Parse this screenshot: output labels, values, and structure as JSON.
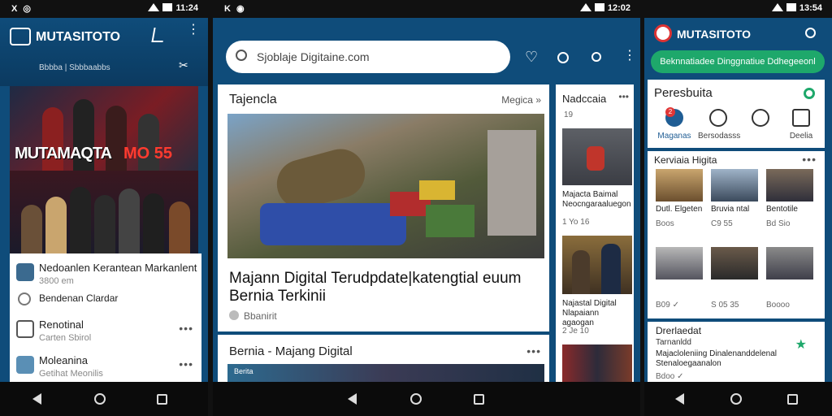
{
  "phone1": {
    "status_left": "X ◎",
    "status_time": "11:24",
    "brand": "MUTASITOTO",
    "subtitle": "Bbbba | Sbbbaabbs",
    "hero_title_a": "MUTAMAQTA",
    "hero_title_b": "MO 55",
    "list": [
      {
        "title": "Nedoanlen Kerantean Markanlent",
        "sub": "3800 em"
      },
      {
        "title": "Bendenan Clardar",
        "sub": ""
      },
      {
        "title": "Renotinal",
        "sub": "Carten Sbirol"
      },
      {
        "title": "Moleanina",
        "sub": "Getihat Meonilis"
      }
    ]
  },
  "phone2": {
    "status_left": "K ◉",
    "status_time": "12:02",
    "search_placeholder": "Sjoblaje Digitaine.com",
    "card_title": "Tajencla",
    "card_more": "Megica »",
    "headline": "Majann Digital Terudpdate|katengtial euum Bernia Terkinii",
    "source": "Bbanirit",
    "side_title": "Nadccaia",
    "side_count": "19",
    "side_items": [
      {
        "cap": "Majacta Baimal Neocngaraaluegon",
        "meta": "1 Yo 16"
      },
      {
        "cap": "Najastal Digital Nlapaiann agaogan",
        "meta": "2 Je 10"
      },
      {
        "cap": "",
        "meta": ""
      }
    ],
    "section2_title": "Bernia - Majang Digital",
    "section2_tag": "Berita"
  },
  "phone3": {
    "status_left": "",
    "status_time": "13:54",
    "brand": "MUTASITOTO",
    "green_banner": "Beknnatiadee Dinggnatiue Ddhegeeonl",
    "section_title": "Peresbuita",
    "tabs": [
      {
        "label": "Maganas",
        "badge": "2"
      },
      {
        "label": "Bersodasss",
        "badge": ""
      },
      {
        "label": "",
        "badge": ""
      },
      {
        "label": "Deelia",
        "badge": ""
      }
    ],
    "grid_title": "Kerviaia Higita",
    "grid_caps": [
      "Dutl. Elgeten",
      "Bruvia ntal",
      "Bentotile"
    ],
    "grid_meta": [
      "Boos",
      "C9 55",
      "Bd Sio"
    ],
    "grid_meta2": [
      "B09 ✓",
      "S 05 35",
      "Boooo"
    ],
    "bottom_title": "Drerlaedat",
    "bottom_sub": "Tarnanldd",
    "bottom_desc": "Majacloleniing Dinalenanddelenal Stenaloegaanalon",
    "bottom_meta": "Bdoo ✓"
  }
}
